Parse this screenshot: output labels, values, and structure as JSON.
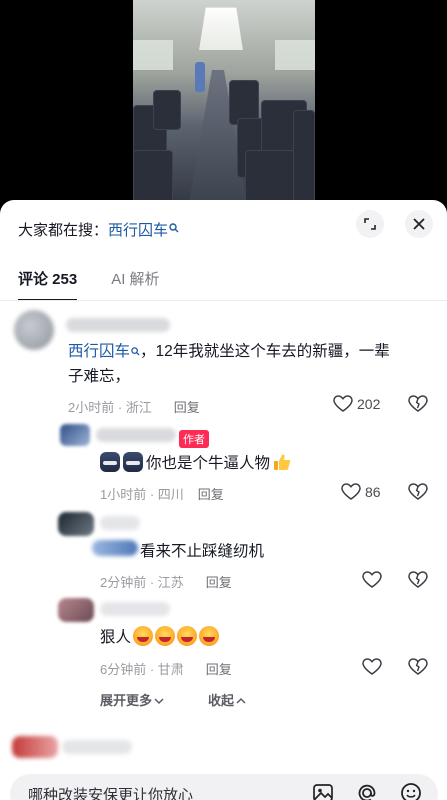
{
  "search": {
    "prefix": "大家都在搜：",
    "term": "西行囚车"
  },
  "tabs": [
    {
      "label": "评论 253",
      "active": true
    },
    {
      "label": "AI 解析",
      "active": false
    }
  ],
  "comments": [
    {
      "mention": "西行囚车",
      "text_line1": "，12年我就坐这个车去的新疆，一辈",
      "text_line2": "子难忘，",
      "time": "2小时前 · 浙江",
      "reply": "回复",
      "likes": "202"
    },
    {
      "badge": "作者",
      "text": "你也是个牛逼人物",
      "time": "1小时前 · 四川",
      "reply": "回复",
      "likes": "86"
    },
    {
      "text": "看来不止踩缝纫机",
      "time": "2分钟前 · 江苏",
      "reply": "回复"
    },
    {
      "text": "狠人",
      "time": "6分钟前 · 甘肃",
      "reply": "回复"
    }
  ],
  "thread_actions": {
    "expand": "展开更多",
    "collapse": "收起"
  },
  "input": {
    "placeholder": "哪种改装安保更让你放心"
  },
  "colors": {
    "mention": "#1c5aa6",
    "author_badge": "#fe2c55"
  }
}
